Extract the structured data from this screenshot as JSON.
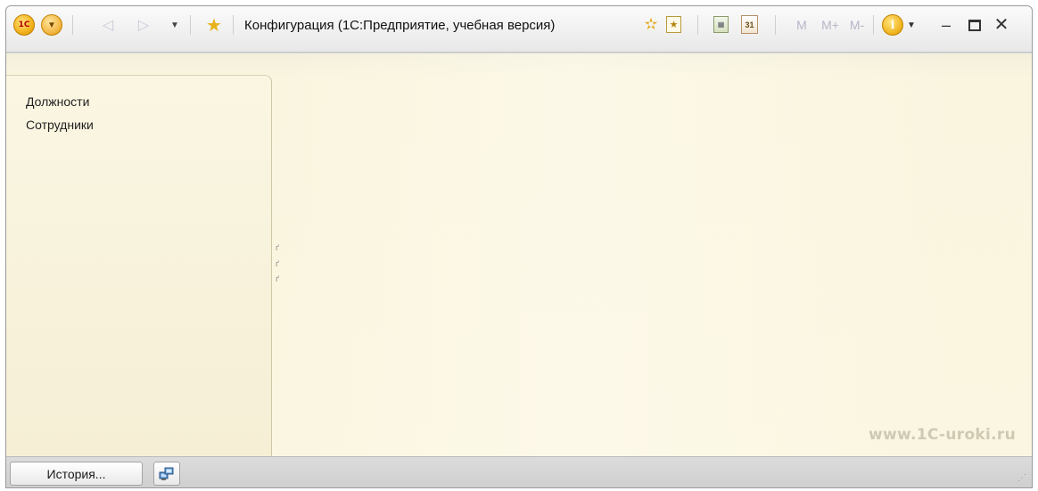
{
  "titlebar": {
    "title": "Конфигурация  (1С:Предприятие, учебная версия)",
    "logo_text": "1С",
    "mem_m": "M",
    "mem_plus": "M+",
    "mem_minus": "M-",
    "calendar_day": "31"
  },
  "sections_panel": {
    "items": [
      {
        "label": "Должности"
      },
      {
        "label": "Сотрудники"
      }
    ]
  },
  "watermark": "www.1C-uroki.ru",
  "statusbar": {
    "history_label": "История..."
  },
  "colors": {
    "background": "#fbf6e1",
    "panel_border": "#cfc7a6",
    "accent": "#f2b21d"
  }
}
